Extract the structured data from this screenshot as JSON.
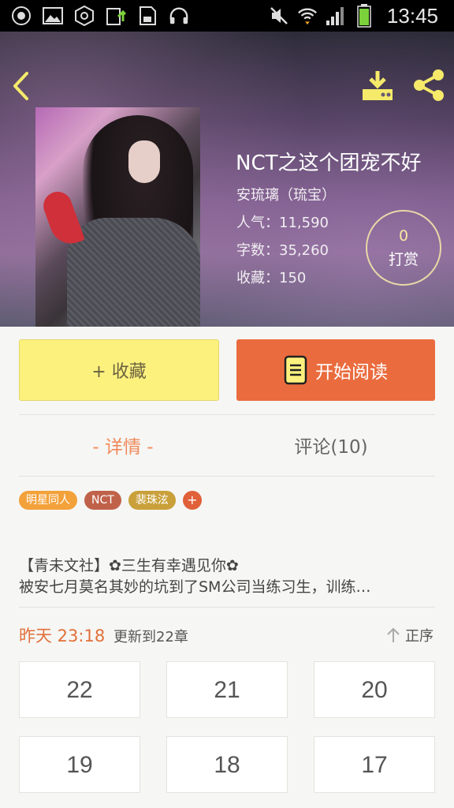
{
  "status_bar": {
    "time": "13:45",
    "left_icons": [
      "app-icon",
      "image-icon",
      "hexagon-icon",
      "upload-icon",
      "sd-card-icon",
      "headphones-icon"
    ],
    "right_icons": [
      "mute-icon",
      "wifi-icon",
      "signal-icon",
      "battery-icon"
    ]
  },
  "book": {
    "title": "NCT之这个团宠不好",
    "author": "安琉璃（琉宝）",
    "popularity": "人气：11,590",
    "word_count": "字数：35,260",
    "favorites": "收藏：150",
    "reward_count": "0",
    "reward_label": "打赏"
  },
  "actions": {
    "favorite_label": "+ 收藏",
    "read_label": "开始阅读"
  },
  "tabs": {
    "detail": "- 详情 -",
    "comments": "评论(10)"
  },
  "tags": [
    {
      "label": "明星同人",
      "color": "#f3a13a"
    },
    {
      "label": "NCT",
      "color": "#c0624a"
    },
    {
      "label": "裴珠泫",
      "color": "#c9a03a"
    }
  ],
  "tag_add": "+",
  "description": {
    "line1": "【青未文社】✿三生有幸遇见你✿",
    "line2": "被安七月莫名其妙的坑到了SM公司当练习生，训练…"
  },
  "update": {
    "time": "昨天 23:18",
    "text": "更新到22章",
    "order_label": "正序"
  },
  "chapters": [
    "22",
    "21",
    "20",
    "19",
    "18",
    "17"
  ],
  "colors": {
    "accent_orange": "#ea6c3e",
    "favorite_yellow": "#fdf17e",
    "icon_yellow": "#f5ea6a"
  }
}
